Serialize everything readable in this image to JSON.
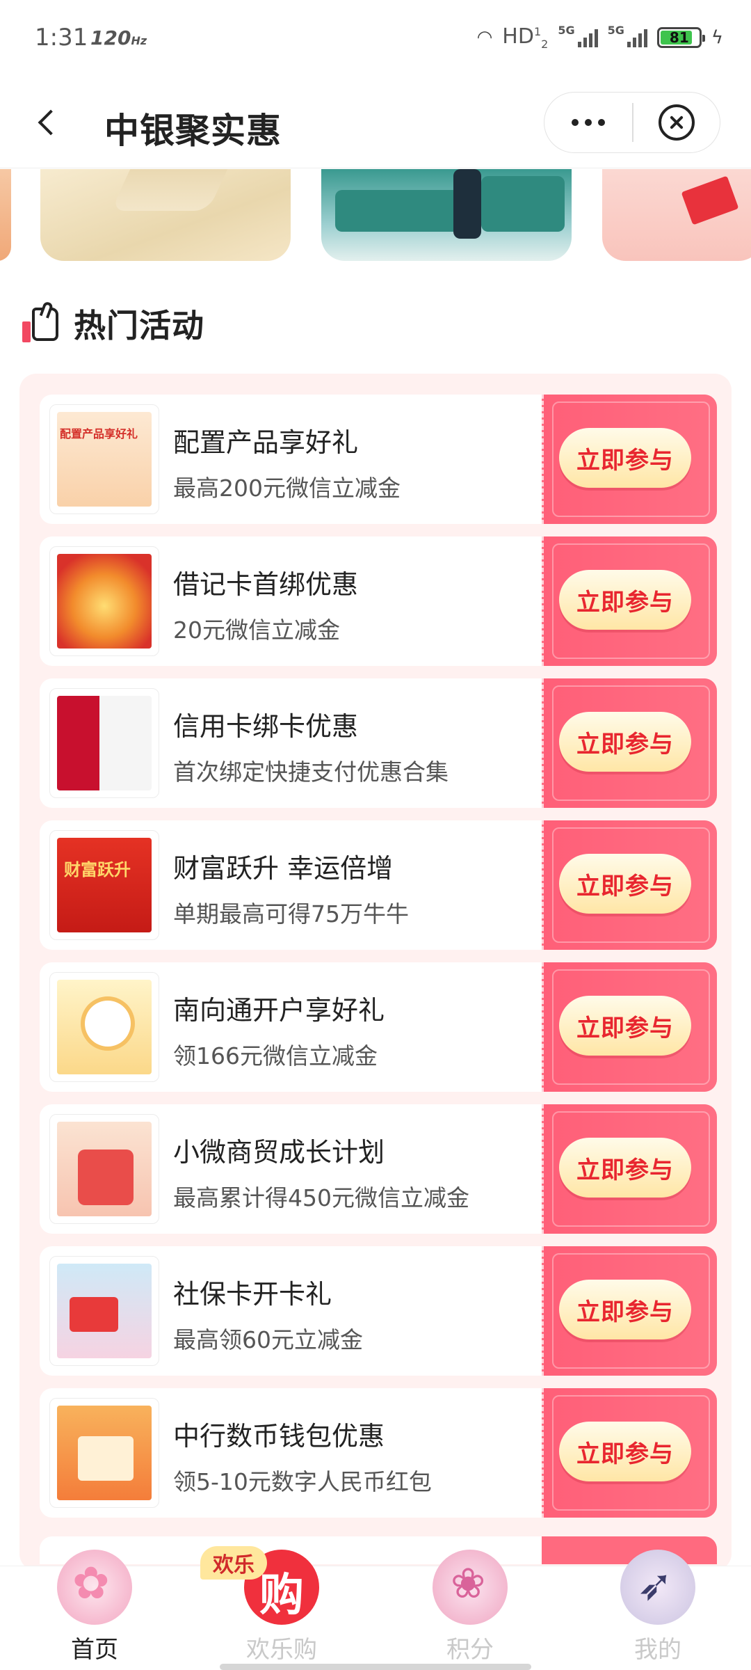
{
  "status_bar": {
    "time": "1:31",
    "refresh_rate": "120",
    "refresh_unit": "Hz",
    "network": "HD",
    "network_sub": "1",
    "net_sub2": "2",
    "signal_1": "5G",
    "signal_2": "5G",
    "battery": "81"
  },
  "nav": {
    "title": "中银聚实惠"
  },
  "section": {
    "title": "热门活动"
  },
  "activities": [
    {
      "title": "配置产品享好礼",
      "subtitle": "最高200元微信立减金",
      "button": "立即参与"
    },
    {
      "title": "借记卡首绑优惠",
      "subtitle": "20元微信立减金",
      "button": "立即参与"
    },
    {
      "title": "信用卡绑卡优惠",
      "subtitle": "首次绑定快捷支付优惠合集",
      "button": "立即参与"
    },
    {
      "title": "财富跃升 幸运倍增",
      "subtitle": "单期最高可得75万牛牛",
      "button": "立即参与"
    },
    {
      "title": "南向通开户享好礼",
      "subtitle": "领166元微信立减金",
      "button": "立即参与"
    },
    {
      "title": "小微商贸成长计划",
      "subtitle": "最高累计得450元微信立减金",
      "button": "立即参与"
    },
    {
      "title": "社保卡开卡礼",
      "subtitle": "最高领60元立减金",
      "button": "立即参与"
    },
    {
      "title": "中行数币钱包优惠",
      "subtitle": "领5-10元数字人民币红包",
      "button": "立即参与"
    }
  ],
  "tab_bar": {
    "tabs": [
      {
        "label": "首页",
        "icon": "sakura-icon",
        "active": true
      },
      {
        "label": "欢乐购",
        "icon": "shop-icon",
        "active": false,
        "badge": "欢乐"
      },
      {
        "label": "积分",
        "icon": "butterfly-icon",
        "active": false
      },
      {
        "label": "我的",
        "icon": "swallow-icon",
        "active": false
      }
    ]
  },
  "colors": {
    "accent": "#ff5f78",
    "button_text": "#e8262f",
    "panel_bg": "#fff1f0"
  }
}
